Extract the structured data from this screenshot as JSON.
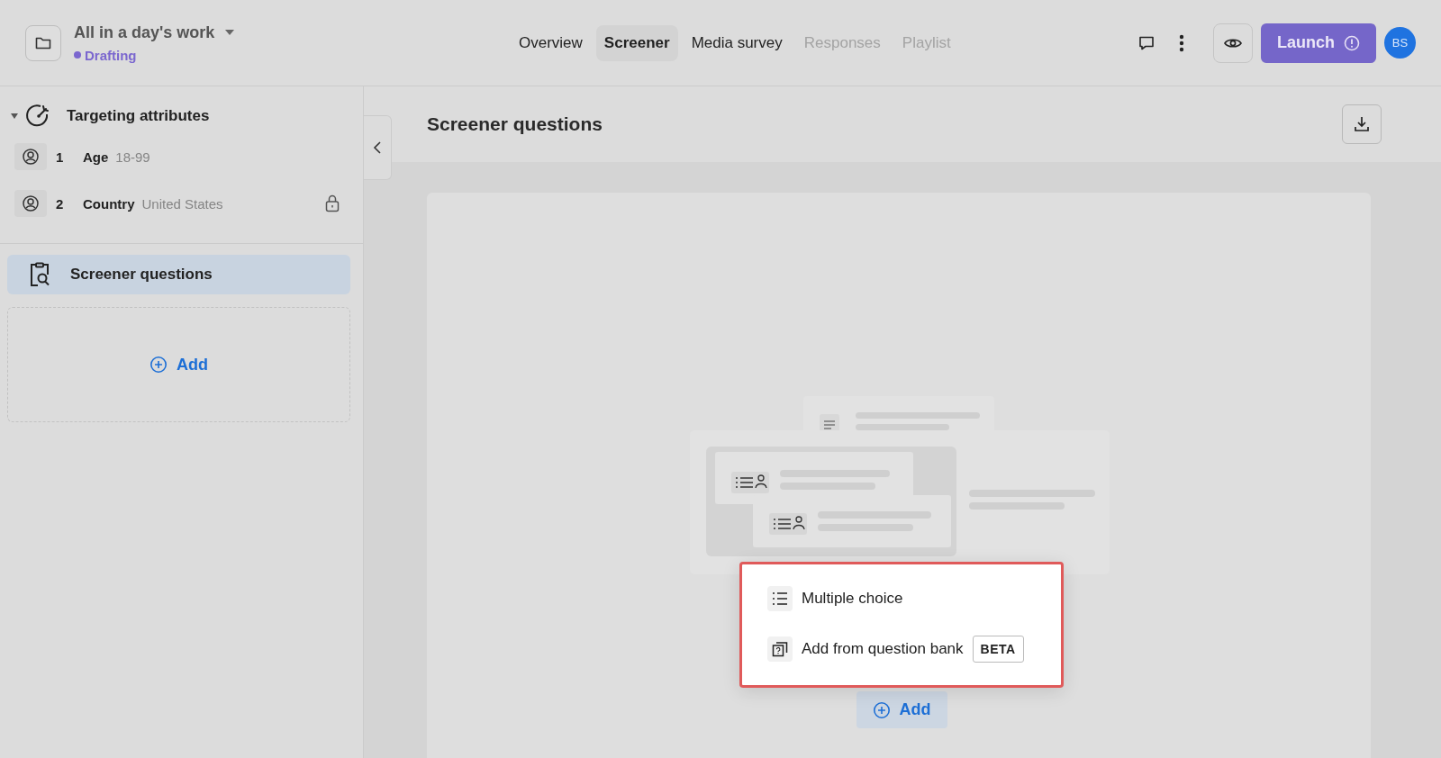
{
  "project": {
    "title": "All in a day's work",
    "status": "Drafting"
  },
  "tabs": [
    {
      "label": "Overview",
      "selected": false,
      "disabled": false
    },
    {
      "label": "Screener",
      "selected": true,
      "disabled": false
    },
    {
      "label": "Media survey",
      "selected": false,
      "disabled": false
    },
    {
      "label": "Responses",
      "selected": false,
      "disabled": true
    },
    {
      "label": "Playlist",
      "selected": false,
      "disabled": true
    }
  ],
  "launch": {
    "label": "Launch"
  },
  "avatar": {
    "initials": "BS"
  },
  "sidebar": {
    "section": {
      "title": "Targeting attributes",
      "expanded": true,
      "items": [
        {
          "number": "1",
          "name": "Age",
          "value": "18-99",
          "locked": false
        },
        {
          "number": "2",
          "name": "Country",
          "value": "United States",
          "locked": true
        }
      ]
    },
    "screener_item": {
      "label": "Screener questions",
      "selected": true
    },
    "add_label": "Add"
  },
  "main": {
    "title": "Screener questions",
    "menu": [
      {
        "kind": "multiple-choice",
        "label": "Multiple choice"
      },
      {
        "kind": "question-bank",
        "label": "Add from question bank",
        "badge": "BETA"
      }
    ],
    "add_label": "Add"
  }
}
